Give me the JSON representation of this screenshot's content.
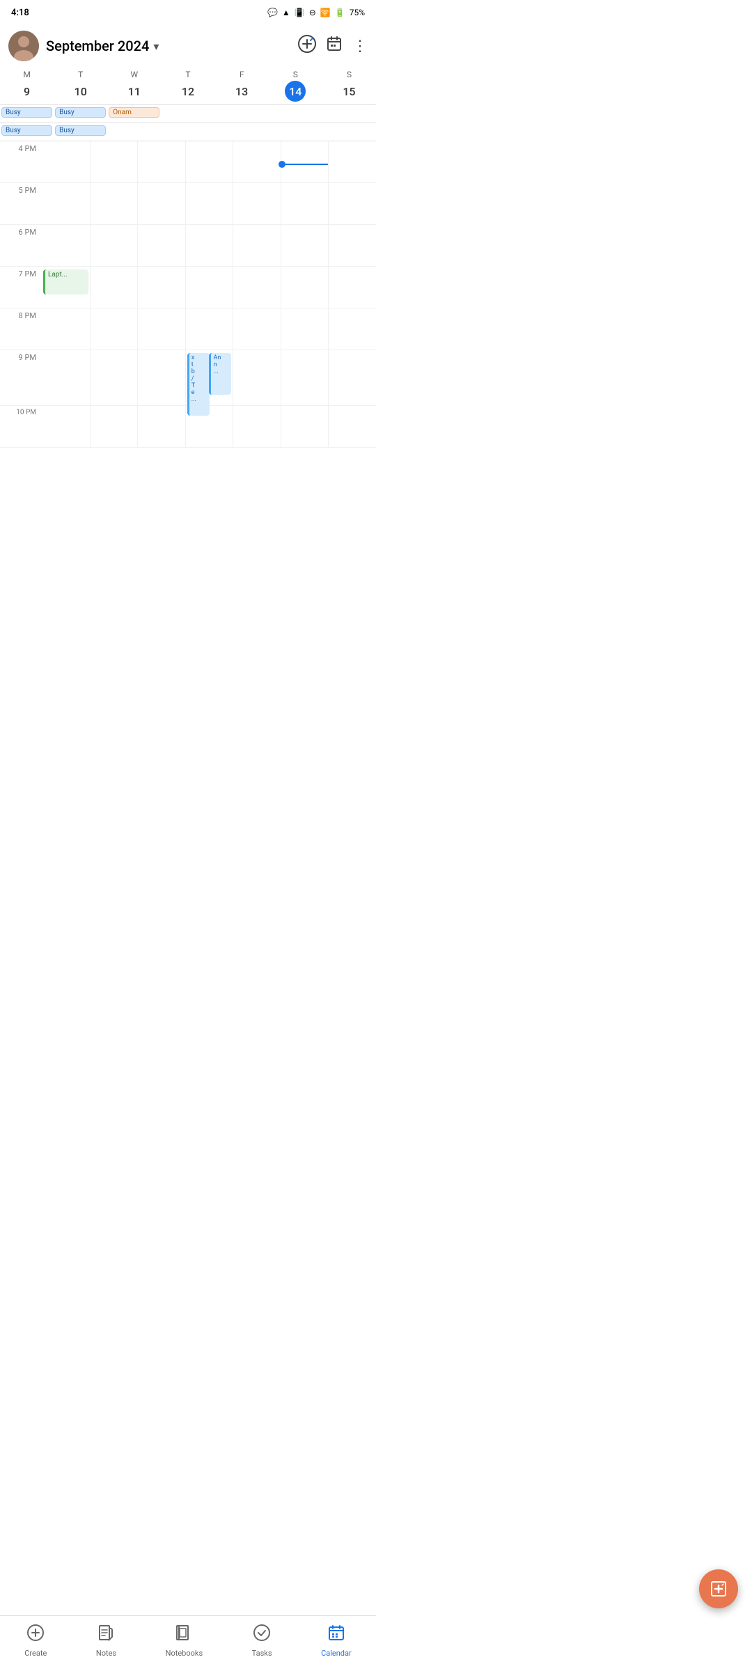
{
  "statusBar": {
    "time": "4:18",
    "battery": "75%",
    "signal": "wifi"
  },
  "header": {
    "monthTitle": "September 2024",
    "dropdownLabel": "expand month",
    "addEventLabel": "add event",
    "calendarIcon": "calendar",
    "moreLabel": "more options"
  },
  "weekDays": [
    {
      "letter": "M",
      "num": "9",
      "today": false
    },
    {
      "letter": "T",
      "num": "10",
      "today": false
    },
    {
      "letter": "W",
      "num": "11",
      "today": false
    },
    {
      "letter": "T",
      "num": "12",
      "today": false
    },
    {
      "letter": "F",
      "num": "13",
      "today": false
    },
    {
      "letter": "S",
      "num": "14",
      "today": true
    },
    {
      "letter": "S",
      "num": "15",
      "today": false
    }
  ],
  "eventChips": [
    {
      "col": 0,
      "label": "Busy",
      "type": "blue"
    },
    {
      "col": 1,
      "label": "Busy",
      "type": "blue"
    },
    {
      "col": 2,
      "label": "Onam",
      "type": "orange"
    },
    {
      "col": 0,
      "label": "Busy",
      "type": "blue",
      "row": 1
    },
    {
      "col": 1,
      "label": "Busy",
      "type": "blue",
      "row": 1
    }
  ],
  "timeSlots": [
    {
      "label": "4 PM"
    },
    {
      "label": "5 PM"
    },
    {
      "label": "6 PM"
    },
    {
      "label": "7 PM"
    },
    {
      "label": "8 PM"
    },
    {
      "label": "9 PM"
    },
    {
      "label": "10 PM"
    }
  ],
  "events": [
    {
      "id": "lapt",
      "label": "Lapt...",
      "col": 0,
      "timeSlot": 3,
      "type": "green"
    },
    {
      "id": "overlap1",
      "label": "xt b / T e ...",
      "col": 3,
      "timeSlot": 5,
      "type": "blue"
    },
    {
      "id": "overlap2",
      "label": "An n ...",
      "col": 3,
      "timeSlot": 5,
      "type": "blue-light"
    }
  ],
  "fab": {
    "label": "create event"
  },
  "bottomNav": [
    {
      "id": "create",
      "label": "Create",
      "icon": "➕",
      "active": false
    },
    {
      "id": "notes",
      "label": "Notes",
      "icon": "📝",
      "active": false
    },
    {
      "id": "notebooks",
      "label": "Notebooks",
      "icon": "📓",
      "active": false
    },
    {
      "id": "tasks",
      "label": "Tasks",
      "icon": "✅",
      "active": false
    },
    {
      "id": "calendar",
      "label": "Calendar",
      "icon": "📅",
      "active": true
    }
  ]
}
